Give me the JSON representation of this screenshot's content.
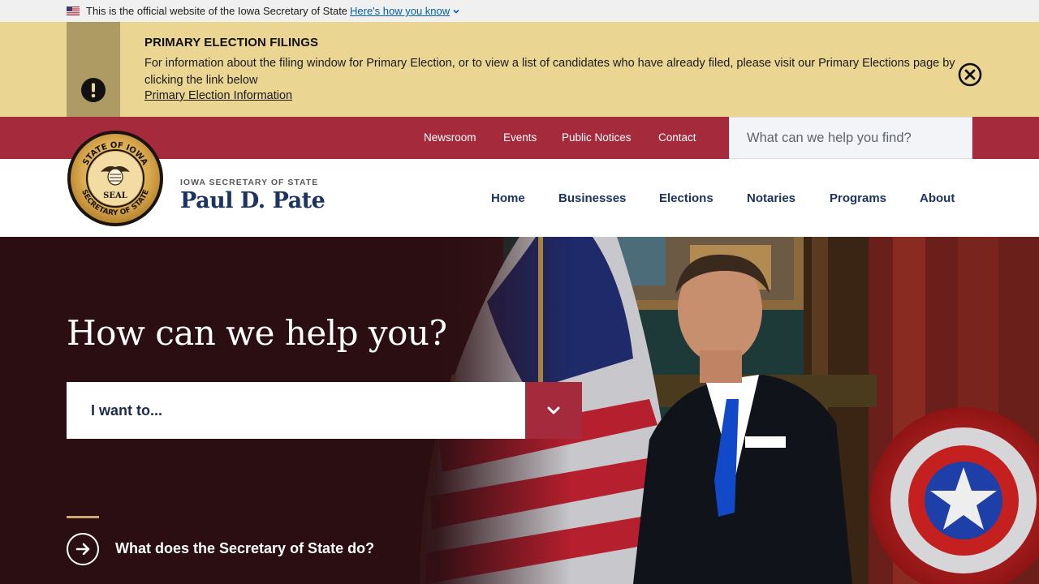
{
  "gov_banner": {
    "text": "This is the official website of the Iowa Secretary of State",
    "link": "Here's how you know"
  },
  "alert": {
    "title": "PRIMARY ELECTION FILINGS",
    "body": "For information about the filing window for Primary Election, or to view a list of candidates who have already filed, please visit our Primary Elections page by clicking the link below",
    "link": "Primary Election Information"
  },
  "utility_nav": {
    "items": [
      "Newsroom",
      "Events",
      "Public Notices",
      "Contact"
    ]
  },
  "search": {
    "placeholder": "What can we help you find?"
  },
  "header": {
    "subtitle": "IOWA SECRETARY OF STATE",
    "name": "Paul D. Pate",
    "seal_text_top": "STATE OF IOWA",
    "seal_text_bottom": "SECRETARY OF STATE",
    "seal_center": "SEAL"
  },
  "main_nav": {
    "items": [
      "Home",
      "Businesses",
      "Elections",
      "Notaries",
      "Programs",
      "About"
    ]
  },
  "hero": {
    "headline": "How can we help you?",
    "select_label": "I want to...",
    "question": "What does the Secretary of State do?"
  },
  "colors": {
    "brand_red": "#a52b3c",
    "navy": "#1c3462",
    "alert_bg": "#ead593",
    "alert_side": "#ad9b63",
    "accent_gold": "#c9a871"
  }
}
